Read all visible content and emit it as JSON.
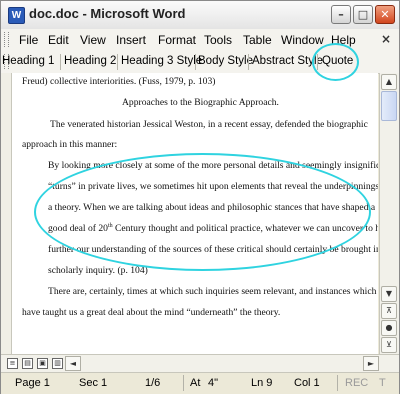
{
  "window": {
    "title": "doc.doc - Microsoft Word",
    "app_icon": "W",
    "controls": {
      "minimize": "–",
      "maximize": "□",
      "close": "✕"
    }
  },
  "menu": {
    "items": [
      "File",
      "Edit",
      "View",
      "Insert",
      "Format",
      "Tools",
      "Table",
      "Window",
      "Help"
    ],
    "close_doc": "×"
  },
  "styles": {
    "items": [
      "Heading 1",
      "Heading 2",
      "Heading 3 Style",
      "Body Style",
      "Abstract Style",
      "Quote"
    ],
    "highlighted": "Quote"
  },
  "document": {
    "lines": [
      "Freud) collective interiorities. (Fuss, 1979, p. 103)",
      "Approaches to the Biographic Approach.",
      "The venerated historian Jessical Weston, in a recent essay, defended the biographic",
      "approach in this manner:",
      "By looking more closely at some of the more personal details and seemingly insignificant",
      "“turns” in private lives, we sometimes hit upon elements that reveal the underpinnings of",
      "a theory. When we are talking about ideas and philosophic stances that have shaped a",
      "good deal of 20",
      "th",
      " Century thought and political practice, whatever we can uncover to help",
      "further our understanding of the sources of these critical should certainly be brought into",
      "scholarly inquiry. (p. 104)",
      "There are, certainly, times at which such inquiries seem relevant, and instances which",
      "have taught us a great deal about the mind “underneath” the theory."
    ]
  },
  "scrollbar": {
    "up": "▲",
    "down": "▼",
    "prev_page": "⊼",
    "select_browse": "●",
    "next_page": "⊻",
    "left": "◄",
    "right": "►"
  },
  "view_buttons": [
    "≡",
    "▤",
    "▣",
    "▥"
  ],
  "status": {
    "page": "Page 1",
    "sec": "Sec 1",
    "page_of": "1/6",
    "at": "At",
    "at_value": "4\"",
    "ln": "Ln 9",
    "col": "Col 1",
    "rec": "REC",
    "trk": "T"
  },
  "accent_colors": {
    "annotation": "#2fd3e0",
    "titlebar_close": "#d2461e"
  }
}
